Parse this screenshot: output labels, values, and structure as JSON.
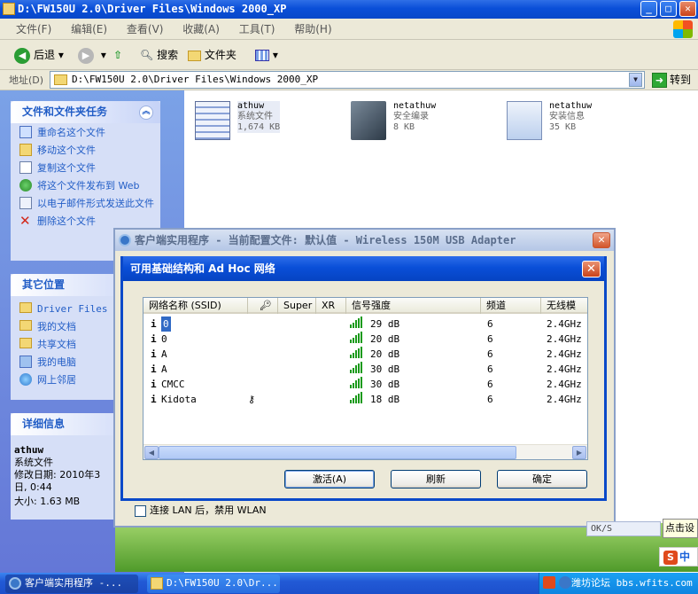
{
  "explorer": {
    "title": "D:\\FW150U 2.0\\Driver Files\\Windows 2000_XP",
    "menu": [
      "文件(F)",
      "编辑(E)",
      "查看(V)",
      "收藏(A)",
      "工具(T)",
      "帮助(H)"
    ],
    "toolbar": {
      "back": "后退",
      "search": "搜索",
      "folders": "文件夹"
    },
    "address_label": "地址(D)",
    "address_value": "D:\\FW150U 2.0\\Driver Files\\Windows 2000_XP",
    "go_label": "转到"
  },
  "left_pane": {
    "tasks_title": "文件和文件夹任务",
    "tasks": [
      "重命名这个文件",
      "移动这个文件",
      "复制这个文件",
      "将这个文件发布到 Web",
      "以电子邮件形式发送此文件",
      "删除这个文件"
    ],
    "places_title": "其它位置",
    "places": [
      "Driver Files",
      "我的文档",
      "共享文档",
      "我的电脑",
      "网上邻居"
    ],
    "details_title": "详细信息",
    "details": {
      "name": "athuw",
      "type": "系统文件",
      "modified": "修改日期: 2010年3",
      "modified_2": "日, 0:44",
      "size": "大小: 1.63 MB"
    }
  },
  "files": [
    {
      "name": "athuw",
      "type": "系统文件",
      "size": "1,674 KB"
    },
    {
      "name": "netathuw",
      "type": "安全编录",
      "size": "8 KB"
    },
    {
      "name": "netathuw",
      "type": "安装信息",
      "size": "35 KB"
    }
  ],
  "client_window": {
    "title": "客户端实用程序 - 当前配置文件: 默认值 - Wireless 150M USB Adapter",
    "lan_checkbox": "连接 LAN 后，禁用 WLAN"
  },
  "network_dialog": {
    "title": "可用基础结构和 Ad Hoc 网络",
    "columns": [
      "网络名称 (SSID)",
      "",
      "Super",
      "XR",
      "信号强度",
      "频道",
      "无线模"
    ],
    "rows": [
      {
        "ssid": "0",
        "lock": false,
        "signal": "29 dB",
        "channel": "6",
        "mode": "2.4GHz"
      },
      {
        "ssid": "0",
        "lock": false,
        "signal": "20 dB",
        "channel": "6",
        "mode": "2.4GHz"
      },
      {
        "ssid": "A",
        "lock": false,
        "signal": "20 dB",
        "channel": "6",
        "mode": "2.4GHz"
      },
      {
        "ssid": "A",
        "lock": false,
        "signal": "30 dB",
        "channel": "6",
        "mode": "2.4GHz"
      },
      {
        "ssid": "CMCC",
        "lock": false,
        "signal": "30 dB",
        "channel": "6",
        "mode": "2.4GHz"
      },
      {
        "ssid": "Kidota",
        "lock": true,
        "signal": "18 dB",
        "channel": "6",
        "mode": "2.4GHz"
      }
    ],
    "buttons": {
      "activate": "激活(A)",
      "refresh": "刷新",
      "ok": "确定"
    }
  },
  "taskbar": {
    "tasks": [
      "客户端实用程序 -...",
      "D:\\FW150U 2.0\\Dr..."
    ],
    "tray_text": "潍坊论坛 bbs.wfits.com"
  },
  "popups": {
    "tip": "点击设",
    "ime": "中",
    "ok_strip": "OK/S"
  }
}
